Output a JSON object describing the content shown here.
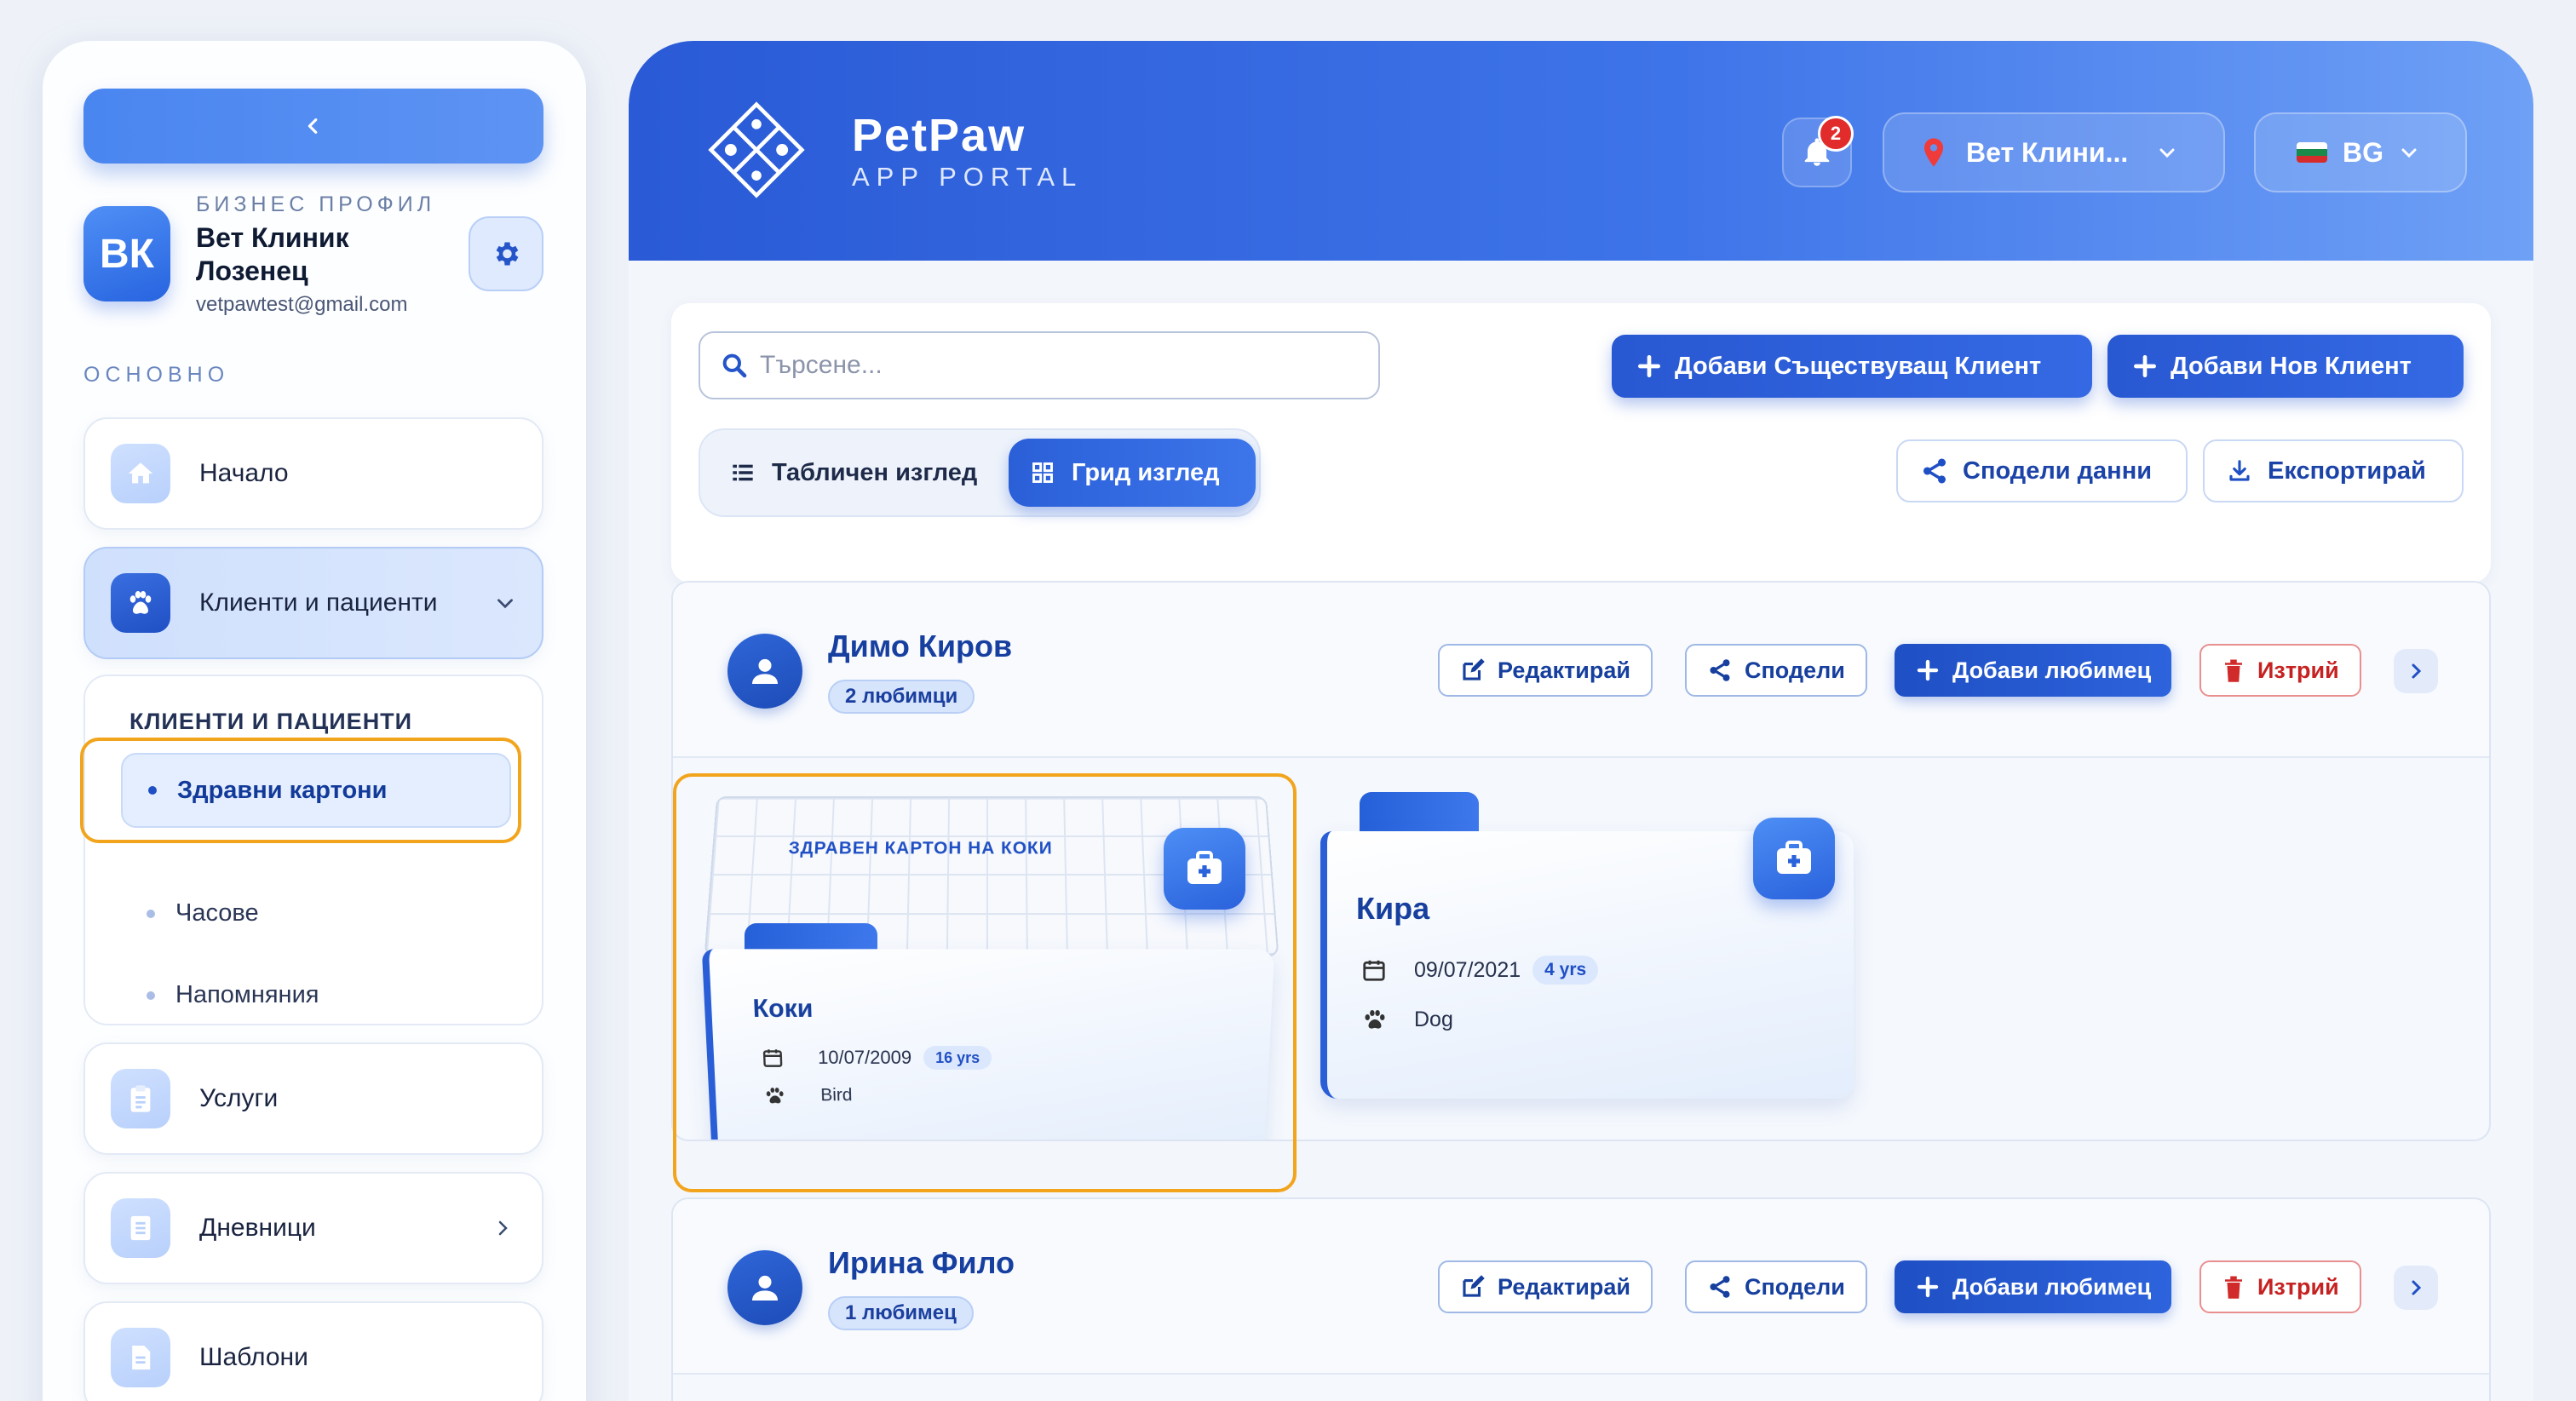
{
  "sidebar": {
    "collapse_icon": "chevron-left-icon",
    "avatar_initials": "ВК",
    "business_label": "БИЗНЕС ПРОФИЛ",
    "business_name": "Вет Клиник Лозенец",
    "business_email": "vetpawtest@gmail.com",
    "section_main": "ОСНОВНО",
    "items": [
      {
        "label": "Начало",
        "icon": "home-icon"
      },
      {
        "label": "Клиенти и пациенти",
        "icon": "paw-icon",
        "active": true
      },
      {
        "label": "Услуги",
        "icon": "clipboard-icon"
      },
      {
        "label": "Дневници",
        "icon": "notebook-icon"
      },
      {
        "label": "Шаблони",
        "icon": "document-icon"
      }
    ],
    "submenu": {
      "title": "КЛИЕНТИ И ПАЦИЕНТИ",
      "items": [
        {
          "label": "Здравни картони",
          "active": true
        },
        {
          "label": "Часове"
        },
        {
          "label": "Напомняния"
        }
      ]
    }
  },
  "header": {
    "brand": "PetPaw",
    "brand_sub": "APP PORTAL",
    "notifications_count": "2",
    "clinic_select": "Вет Клини...",
    "language": "BG"
  },
  "toolbar": {
    "search_placeholder": "Търсене...",
    "add_existing_client": "Добави Съществуващ Клиент",
    "add_new_client": "Добави Нов Клиент",
    "view_table": "Табличен изглед",
    "view_grid": "Грид изглед",
    "share_data": "Сподели данни",
    "export": "Експортирай"
  },
  "clients": [
    {
      "name": "Димо Киров",
      "pet_count": "2 любимци",
      "actions": {
        "edit": "Редактирай",
        "share": "Сподели",
        "add_pet": "Добави любимец",
        "delete": "Изтрий"
      },
      "pets": [
        {
          "name": "Коки",
          "birthdate": "10/07/2009",
          "age": "16 yrs",
          "species": "Bird",
          "card_title": "ЗДРАВЕН КАРТОН НА КОКИ"
        },
        {
          "name": "Кира",
          "birthdate": "09/07/2021",
          "age": "4 yrs",
          "species": "Dog"
        }
      ]
    },
    {
      "name": "Ирина Фило",
      "pet_count": "1 любимец",
      "actions": {
        "edit": "Редактирай",
        "share": "Сподели",
        "add_pet": "Добави любимец",
        "delete": "Изтрий"
      }
    }
  ],
  "colors": {
    "primary": "#2858d2",
    "accent_highlight": "#f2a41d",
    "danger": "#c62222",
    "notification_badge": "#e22b2b"
  }
}
